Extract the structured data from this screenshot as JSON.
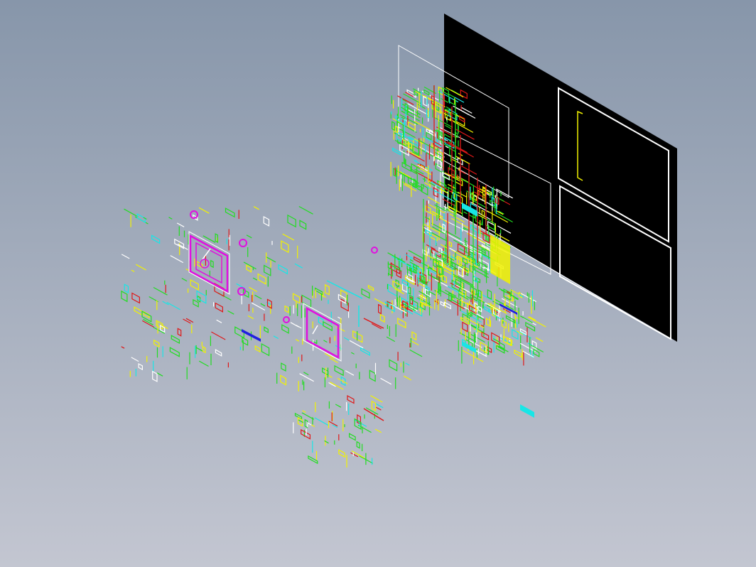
{
  "viewport": {
    "background_top": "#8796aa",
    "background_bottom": "#c3c6d1"
  },
  "palette": {
    "sheet_fill": "#000000",
    "frame_white": "#ffffff",
    "green": "#22dd22",
    "yellow": "#f2f200",
    "red": "#e01818",
    "cyan": "#18e6e6",
    "magenta": "#e010e0",
    "blue": "#2020e0",
    "white": "#ffffff"
  },
  "model": {
    "layers": [
      "drawing-sheet",
      "title-frames",
      "assembly-cluster",
      "left-parts",
      "center-parts",
      "lower-parts"
    ]
  }
}
